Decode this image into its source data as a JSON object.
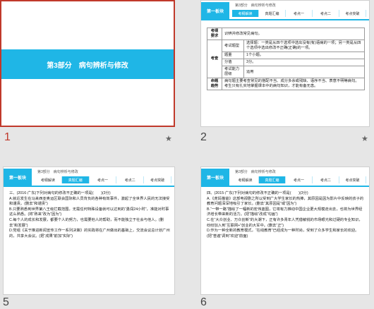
{
  "slides": [
    {
      "number": "1",
      "title": "第3部分　病句辨析与修改"
    },
    {
      "number": "2",
      "breadcrumb": "第3部分　病句辨析与修改",
      "logo": "第一板块",
      "tabs": [
        "考纲解读",
        "真题汇编",
        "考点一",
        "考点二",
        "考点突破"
      ],
      "table": {
        "r1": [
          "考纲要求",
          "识辨并修改常见病句。"
        ],
        "r2": [
          "考查",
          "考试题型",
          "选择题：一类是从四个选项中选出没有(有)语病的一项；另一类是从四个选项中选出修改不正确(正确)的一项。"
        ],
        "r3": [
          "题量",
          "1个小题。"
        ],
        "r4": [
          "分值",
          "3分。"
        ],
        "r5": [
          "考试能力层级",
          "运用"
        ],
        "r6": [
          "命题趋势",
          "病句题主要考查常见的搭配不当、成分多余或残缺、语序不当、表意不明等病句。考生只有扎实地掌握课本中的病句知识，才能有备无患。"
        ]
      }
    },
    {
      "number": "5",
      "breadcrumb": "第3部分　病句辨析与修改",
      "logo": "第一板块",
      "tabs": [
        "考纲解读",
        "真题汇编",
        "考点一",
        "考点二",
        "考点突破"
      ],
      "lines": [
        "三、(2016·广东)下列对病句的修改不正确的一项是(　　)(3分)",
        "A.就近发生在马来西亚奥运区联会国际和人员背负的各种有效事件，激起了全世界人民的无法接受和谴责。(删去“和谴责”)",
        "B.只要熟悉到世界第八王级拦截范围，无需任何特殊设备就可以达到的“勇闯24小时”，准能对时事这么熟悉。(将“熟来”改为“因为”)",
        "C.每个人的成长和发展，都要个人的努力，也需要他人的帮助，而不能独立于社会与他人。(删去“和发展”)",
        "D.党组《关于推进新闻宣传工作一系列决策》的实践将在广州做出的基础上，交流会议总计划广州的，共享大会议。(把“成果”前加“实际”)"
      ]
    },
    {
      "number": "6",
      "breadcrumb": "第3部分　病句辨析与修改",
      "logo": "第一板块",
      "tabs": [
        "考纲解读",
        "真题汇编",
        "考点一",
        "考点二",
        "考点突破"
      ],
      "lines": [
        "四、(2015·广东)下列对病句的修改不正确的一项是(　　)(3分)",
        "A.《虎妈猫爸》这部电视剧之所以受到广大学生家长的热捧，其原因是因为影片中反映的孩子的教育问题深深地吸引了家长。(删去“其原因是”或“因为”)",
        "B.“一带一路”描绘了一幅新的宏伟蓝图，它将有力推动中国企业更大规模走出去，也将为世界经济增长带来新的活力。(把“描绘”改成“勾画”)",
        "C.在“大众创业、万众创新”的大潮下，正有许多青年人凭借敏锐的市场眼光和过硬的专业知识，纷纷加入到“互联网+”创业的大军中。(删去“正”)",
        "D.作为一种全新的教育模式，“在线教育”已经成为一种时尚，受到了众多学生和家长的欢迎。(把“普遍”调到“欢迎”前面)"
      ]
    }
  ]
}
